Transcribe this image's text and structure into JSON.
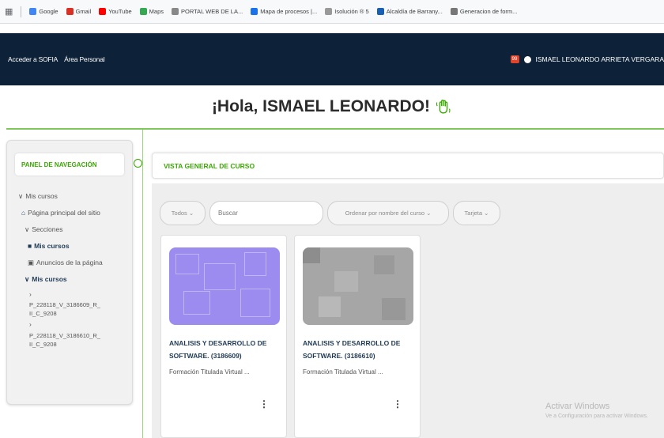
{
  "bookmarks": {
    "apps_icon": "apps-grid-icon",
    "items": [
      {
        "label": "Google",
        "color": "#4285f4"
      },
      {
        "label": "Gmail",
        "color": "#d93025"
      },
      {
        "label": "YouTube",
        "color": "#ff0000"
      },
      {
        "label": "Maps",
        "color": "#34a853"
      },
      {
        "label": "PORTAL WEB DE LA...",
        "color": "#888888"
      },
      {
        "label": "Mapa de procesos |...",
        "color": "#1a73e8"
      },
      {
        "label": "Isolución ® 5",
        "color": "#999999"
      },
      {
        "label": "Alcaldía de Barrany...",
        "color": "#1a5fb4"
      },
      {
        "label": "Generacion de form...",
        "color": "#777777"
      }
    ]
  },
  "header": {
    "links": [
      "Acceder a SOFIA",
      "Área Personal"
    ],
    "notification_badge": "99",
    "user_name": "ISMAEL LEONARDO ARRIETA VERGARA"
  },
  "greeting": {
    "text": "¡Hola, ISMAEL LEONARDO!",
    "icon": "waving-hand-icon"
  },
  "sidebar": {
    "title": "PANEL DE NAVEGACIÓN",
    "items": [
      {
        "label": "Mis cursos",
        "prefix": "∨",
        "style": "normal"
      },
      {
        "label": "Página principal del sitio",
        "prefix": "⌂",
        "style": "normal"
      },
      {
        "label": "Secciones",
        "prefix": "∨",
        "style": "normal"
      },
      {
        "label": "Mis cursos",
        "prefix": "■",
        "style": "bold"
      },
      {
        "label": "Anuncios de la página",
        "prefix": "▣",
        "style": "normal"
      },
      {
        "label": "Mis cursos",
        "prefix": "∨",
        "style": "bold"
      }
    ],
    "course_codes": [
      {
        "line1": "P_228118_V_3186609_R_",
        "line2": "II_C_9208"
      },
      {
        "line1": "P_228118_V_3186610_R_",
        "line2": "II_C_9208"
      }
    ]
  },
  "overview": {
    "title": "VISTA GENERAL DE CURSO",
    "filters": {
      "all": "Todos",
      "search_placeholder": "Buscar",
      "sort": "Ordenar por nombre del curso",
      "view": "Tarjeta"
    }
  },
  "courses": [
    {
      "title": "ANALISIS Y DESARROLLO DE SOFTWARE. (3186609)",
      "subtitle": "Formación Titulada Virtual ...",
      "menu": "⋮",
      "thumb_color": "#9d8cf0"
    },
    {
      "title": "ANALISIS Y DESARROLLO DE SOFTWARE. (3186610)",
      "subtitle": "Formación Titulada Virtual ...",
      "menu": "⋮",
      "thumb_color": "#a6a6a6"
    }
  ],
  "watermark": {
    "line1": "Activar Windows",
    "line2": "Ve a Configuración para activar Windows."
  },
  "colors": {
    "header_bg": "#0d2238",
    "accent_green": "#39a900",
    "course_title": "#1f3a57"
  }
}
